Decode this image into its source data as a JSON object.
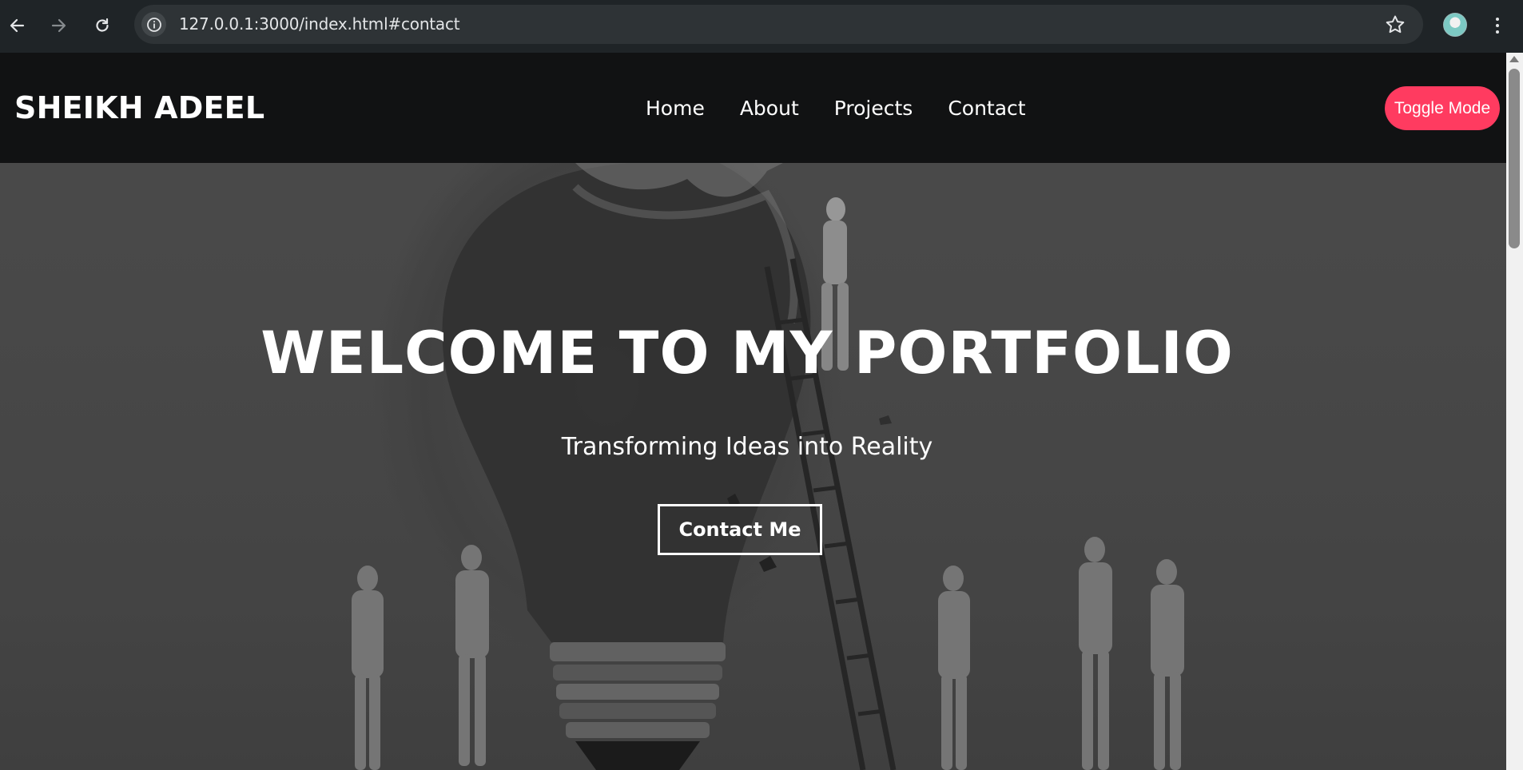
{
  "browser": {
    "url": "127.0.0.1:3000/index.html#contact",
    "icons": [
      "back-icon",
      "forward-icon",
      "reload-icon",
      "info-icon",
      "star-icon",
      "profile-avatar",
      "kebab-menu-icon"
    ]
  },
  "header": {
    "brand": "SHEIKH ADEEL",
    "nav": {
      "home": "Home",
      "about": "About",
      "projects": "Projects",
      "contact": "Contact"
    },
    "toggle_label": "Toggle Mode"
  },
  "hero": {
    "title": "WELCOME TO MY PORTFOLIO",
    "subtitle": "Transforming Ideas into Reality",
    "cta_label": "Contact Me"
  },
  "colors": {
    "header_bg": "#111213",
    "toggle_bg": "#ff3b60",
    "hero_bg": "#555555",
    "text": "#ffffff"
  }
}
